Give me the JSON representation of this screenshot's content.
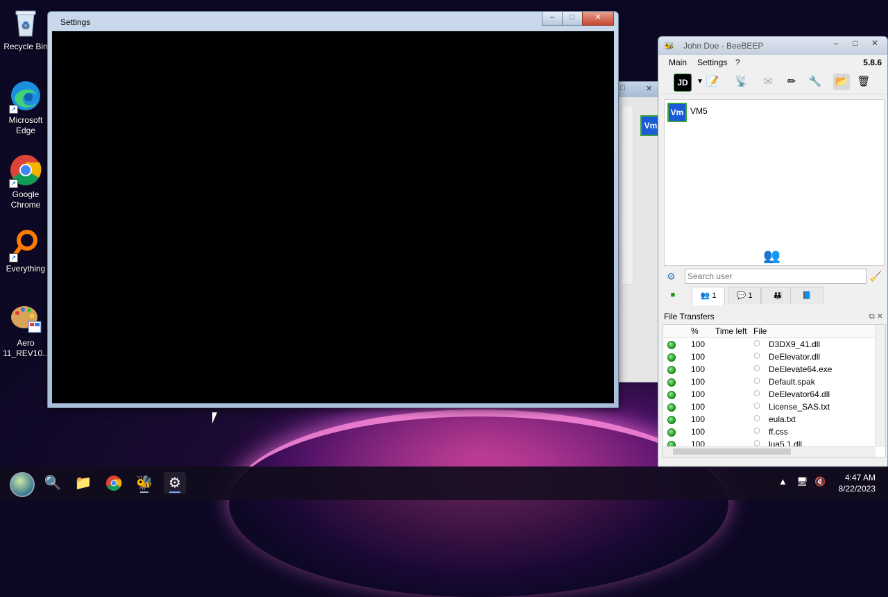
{
  "desktop": {
    "icons": [
      {
        "label": "Recycle Bin",
        "icon": "recycle-bin-icon"
      },
      {
        "label": "Microsoft Edge",
        "icon": "edge-icon"
      },
      {
        "label": "Google Chrome",
        "icon": "chrome-icon"
      },
      {
        "label": "Everything",
        "icon": "everything-icon"
      },
      {
        "label": "Aero 11_REV10....",
        "icon": "aero-icon"
      }
    ]
  },
  "settings_window": {
    "title": "Settings",
    "controls": {
      "minimize": "–",
      "maximize": "□",
      "close": "✕"
    }
  },
  "beebeep": {
    "title": "John Doe - BeeBEEP",
    "version": "5.8.6",
    "menu": [
      "Main",
      "Settings",
      "?"
    ],
    "profile_initials": "JD",
    "users": [
      {
        "initials": "Vm",
        "name": "VM5"
      }
    ],
    "search_placeholder": "Search user",
    "tabs": [
      {
        "icon": "users-icon",
        "count": "1"
      },
      {
        "icon": "chat-icon",
        "count": "1"
      },
      {
        "icon": "groups-icon",
        "count": ""
      },
      {
        "icon": "share-icon",
        "count": ""
      }
    ],
    "file_transfers": {
      "title": "File Transfers",
      "columns": [
        "%",
        "Time left",
        "File"
      ],
      "rows": [
        {
          "pct": "100",
          "file": "D3DX9_41.dll"
        },
        {
          "pct": "100",
          "file": "DeElevator.dll"
        },
        {
          "pct": "100",
          "file": "DeElevate64.exe"
        },
        {
          "pct": "100",
          "file": "Default.spak"
        },
        {
          "pct": "100",
          "file": "DeElevator64.dll"
        },
        {
          "pct": "100",
          "file": "License_SAS.txt"
        },
        {
          "pct": "100",
          "file": "eula.txt"
        },
        {
          "pct": "100",
          "file": "ff.css"
        },
        {
          "pct": "100",
          "file": "lua5.1.dll"
        }
      ]
    }
  },
  "behind_window": {
    "badge": "Vm"
  },
  "taskbar": {
    "time": "4:47 AM",
    "date": "8/22/2023"
  }
}
